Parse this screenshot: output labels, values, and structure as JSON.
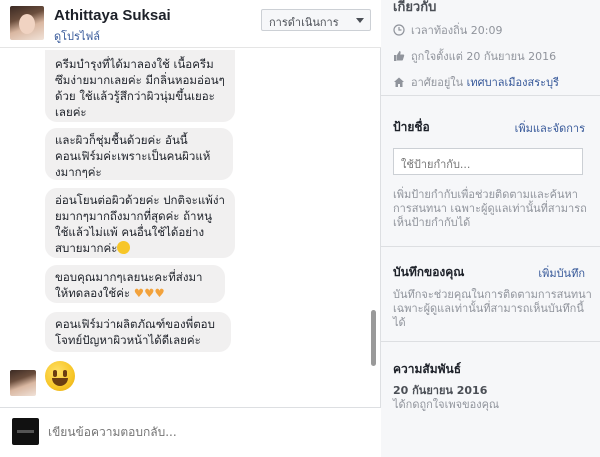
{
  "header": {
    "name": "Athittaya Suksai",
    "profile_link": "ดูโปรไฟล์",
    "action_button": "การดำเนินการ"
  },
  "messages": [
    {
      "text": "ครีมบำรุงที่ได้มาลองใช้ เนื้อครีมซึมง่ายมากเลยค่ะ มีกลิ่นหอมอ่อนๆด้วย ใช้แล้วรู้สึกว่าผิวนุ่มขึ้นเยอะเลยค่ะ"
    },
    {
      "text": "และผิวก็ชุ่มชื้นด้วยค่ะ อันนี้คอนเฟิร์มค่ะเพราะเป็นคนผิวแห้งมากๆค่ะ"
    },
    {
      "text": "อ่อนโยนต่อผิวด้วยค่ะ ปกติจะแพ้ง่ายมากๆมากถึงมากที่สุดค่ะ ถ้าหนูใช้แล้วไม่แพ้ คนอื่นใช้ได้อย่างสบายมากค่ะ",
      "emoji": "smiley-icon"
    },
    {
      "text": "ขอบคุณมากๆเลยนะคะที่ส่งมาให้ทดลองใช้ค่ะ",
      "suffix": "♥♥♥",
      "suffix_icon": "hearts-icon"
    },
    {
      "text": "คอนเฟิร์มว่าผลิตภัณฑ์ของพี่ตอบโจทย์ปัญหาผิวหน้าได้ดีเลยค่ะ"
    }
  ],
  "last_message_icon": "big-smiley-icon",
  "composer": {
    "placeholder": "เขียนข้อความตอบกลับ...",
    "icons": [
      "paperclip-icon",
      "emoji-icon",
      "sticker-icon",
      "like-icon"
    ]
  },
  "info": {
    "heading": "เกี่ยวกับ",
    "local_time": "เวลาท้องถิ่น 20:09",
    "liked_since": "ถูกใจตั้งแต่ 20 กันยายน 2016",
    "lives_in_label": "อาศัยอยู่ใน",
    "lives_in_place": "เทศบาลเมืองสระบุรี"
  },
  "labels": {
    "title": "ป้ายชื่อ",
    "link": "เพิ่มและจัดการ",
    "input_placeholder": "ใช้ป้ายกำกับ...",
    "description": "เพิ่มป้ายกำกับเพื่อช่วยติดตามและค้นหาการสนทนา เฉพาะผู้ดูแลเท่านั้นที่สามารถเห็นป้ายกำกับได้"
  },
  "notes": {
    "title": "บันทึกของคุณ",
    "link": "เพิ่มบันทึก",
    "description": "บันทึกจะช่วยคุณในการติดตามการสนทนา เฉพาะผู้ดูแลเท่านั้นที่สามารถเห็นบันทึกนี้ได้"
  },
  "activity": {
    "title": "ความสัมพันธ์",
    "date": "20 กันยายน 2016",
    "detail": "ได้กดถูกใจเพจของคุณ"
  },
  "colors": {
    "link": "#365899",
    "bubble": "#f1f0f0",
    "panel_bg": "#f6f7f9",
    "like_blue": "#4267b2"
  }
}
